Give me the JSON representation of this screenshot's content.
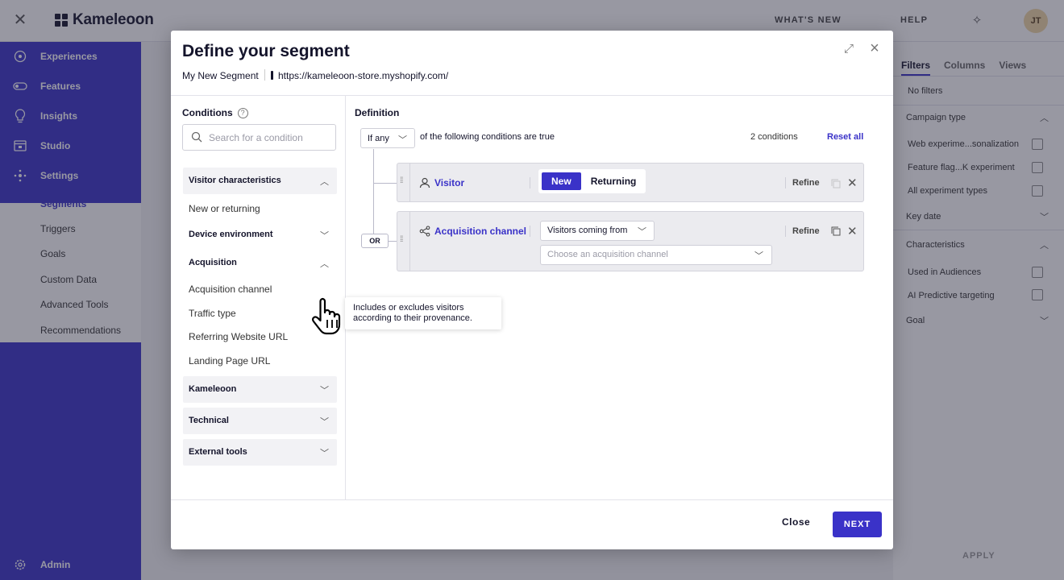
{
  "app": {
    "brand": "Kameleoon",
    "header": {
      "whats_new": "WHAT'S NEW",
      "help": "HELP",
      "avatar_initials": "JT"
    },
    "sidebar": {
      "items": [
        {
          "label": "Experiences",
          "icon": "experiences-icon"
        },
        {
          "label": "Features",
          "icon": "features-icon"
        },
        {
          "label": "Insights",
          "icon": "bulb-icon"
        },
        {
          "label": "Studio",
          "icon": "studio-icon"
        },
        {
          "label": "Settings",
          "icon": "settings-icon"
        }
      ],
      "submenu": [
        "Segments",
        "Triggers",
        "Goals",
        "Custom Data",
        "Advanced Tools",
        "Recommendations"
      ],
      "active_submenu": "Segments",
      "admin": "Admin"
    },
    "filters_panel": {
      "tabs": [
        "Filters",
        "Columns",
        "Views"
      ],
      "no_filters": "No filters",
      "campaign_type": "Campaign type",
      "campaign_options": [
        "Web experime...sonalization",
        "Feature flag...K experiment",
        "All experiment types"
      ],
      "key_date": "Key date",
      "characteristics": "Characteristics",
      "characteristic_options": [
        "Used in Audiences",
        "AI Predictive targeting"
      ],
      "goal": "Goal",
      "apply": "APPLY"
    }
  },
  "modal": {
    "title": "Define your segment",
    "segment_name": "My New Segment",
    "url": "https://kameleoon-store.myshopify.com/",
    "conditions": {
      "title": "Conditions",
      "help": "?",
      "search_placeholder": "Search for a condition",
      "categories": {
        "visitor_characteristics": {
          "label": "Visitor characteristics",
          "items": [
            "New or returning"
          ]
        },
        "device_environment": {
          "label": "Device environment"
        },
        "acquisition": {
          "label": "Acquisition",
          "items": [
            "Acquisition channel",
            "Traffic type",
            "Referring Website URL",
            "Landing Page URL"
          ]
        },
        "kameleoon": {
          "label": "Kameleoon"
        },
        "technical": {
          "label": "Technical"
        },
        "external_tools": {
          "label": "External tools"
        }
      }
    },
    "tooltip": {
      "line1": "Includes or excludes visitors",
      "line2": "according to their provenance."
    },
    "definition": {
      "title": "Definition",
      "operator": "If any",
      "suffix": "of the following conditions are true",
      "count": "2 conditions",
      "reset": "Reset all",
      "or_label": "OR",
      "conditions": [
        {
          "name": "Visitor",
          "toggle": [
            "New",
            "Returning"
          ],
          "selected": "New",
          "refine": "Refine"
        },
        {
          "name": "Acquisition channel",
          "dropdown": "Visitors coming from",
          "channel_placeholder": "Choose an acquisition channel",
          "refine": "Refine"
        }
      ]
    },
    "footer": {
      "close": "Close",
      "next": "NEXT"
    }
  },
  "colors": {
    "primary": "#3a32c8",
    "overlay": "rgba(40,40,60,0.48)"
  }
}
